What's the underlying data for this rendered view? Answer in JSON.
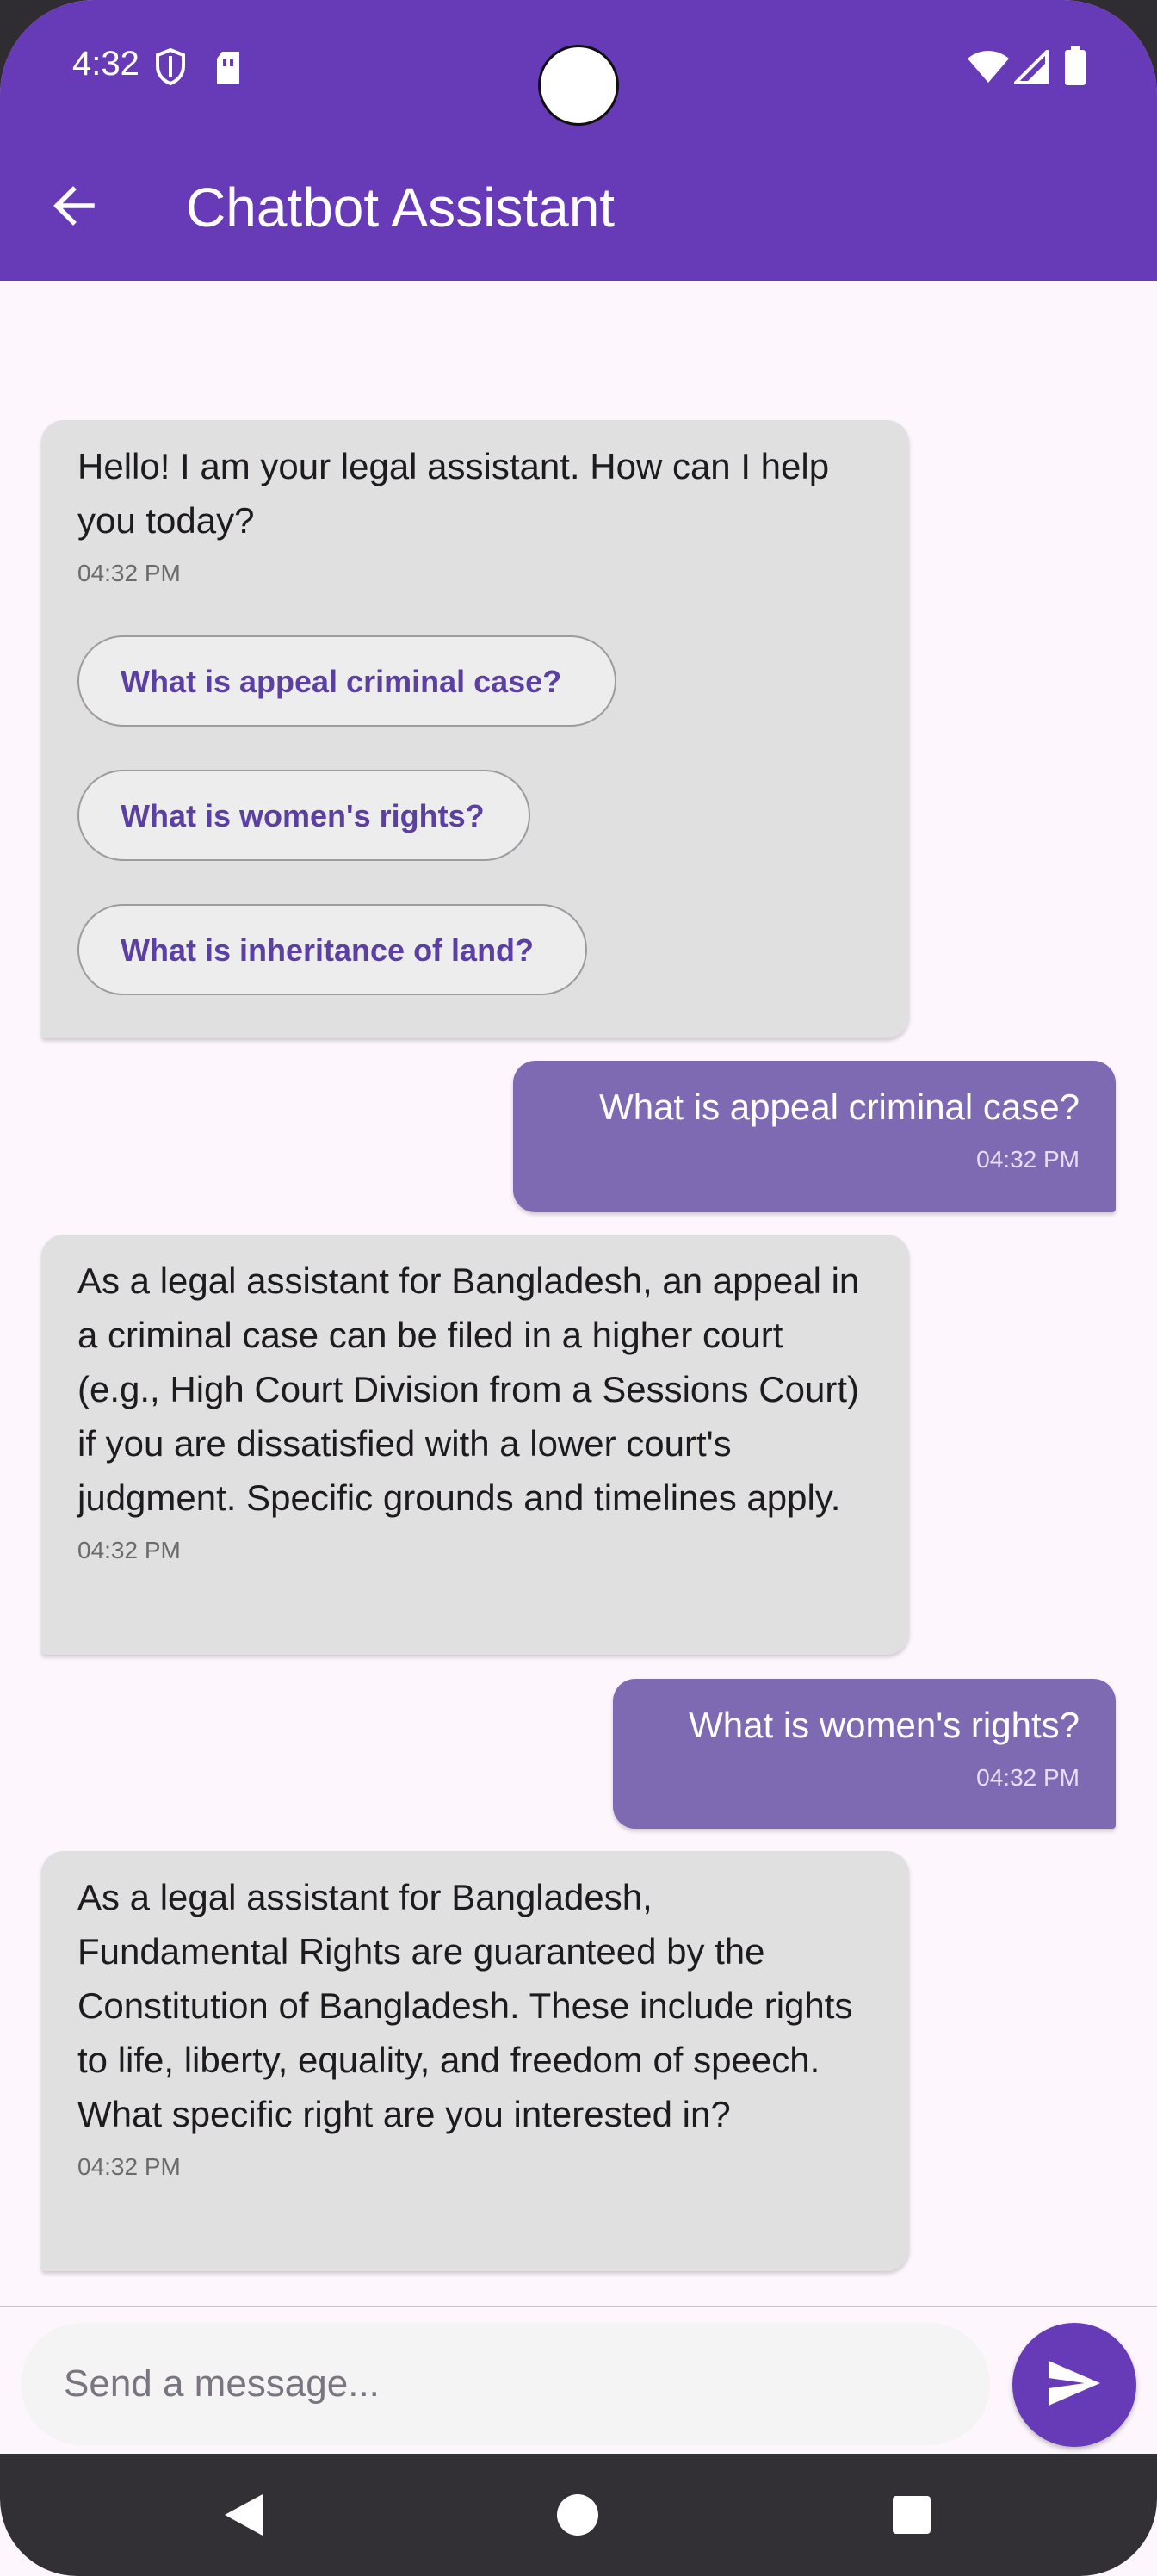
{
  "status_bar": {
    "time": "4:32"
  },
  "app_bar": {
    "title": "Chatbot Assistant"
  },
  "messages": [
    {
      "sender": "bot",
      "text": "Hello! I am your legal assistant. How can I help you today?",
      "time": "04:32 PM",
      "suggestions": [
        "What is appeal criminal case?",
        "What is women's rights?",
        "What is inheritance of land?"
      ]
    },
    {
      "sender": "user",
      "text": "What is appeal criminal case?",
      "time": "04:32 PM"
    },
    {
      "sender": "bot",
      "text": "As a legal assistant for Bangladesh, an appeal in a criminal case can be filed in a higher court (e.g., High Court Division from a Sessions Court) if you are dissatisfied with a lower court's judgment. Specific grounds and timelines apply.",
      "time": "04:32 PM"
    },
    {
      "sender": "user",
      "text": "What is women's rights?",
      "time": "04:32 PM"
    },
    {
      "sender": "bot",
      "text": "As a legal assistant for Bangladesh, Fundamental Rights are guaranteed by the Constitution of Bangladesh. These include rights to life, liberty, equality, and freedom of speech. What specific right are you interested in?",
      "time": "04:32 PM"
    }
  ],
  "composer": {
    "placeholder": "Send a message...",
    "value": ""
  },
  "colors": {
    "primary": "#673ab7",
    "user_bubble": "#7e6ab2",
    "bot_bubble": "#e0e0e0",
    "background": "#fdf6fd"
  },
  "icons": {
    "back": "arrow-left-icon",
    "send": "send-icon",
    "shield": "shield-icon",
    "sim": "sim-card-icon",
    "wifi": "wifi-icon",
    "signal": "signal-icon",
    "battery": "battery-icon",
    "nav_back": "nav-back-icon",
    "nav_home": "nav-home-icon",
    "nav_recents": "nav-recents-icon"
  }
}
